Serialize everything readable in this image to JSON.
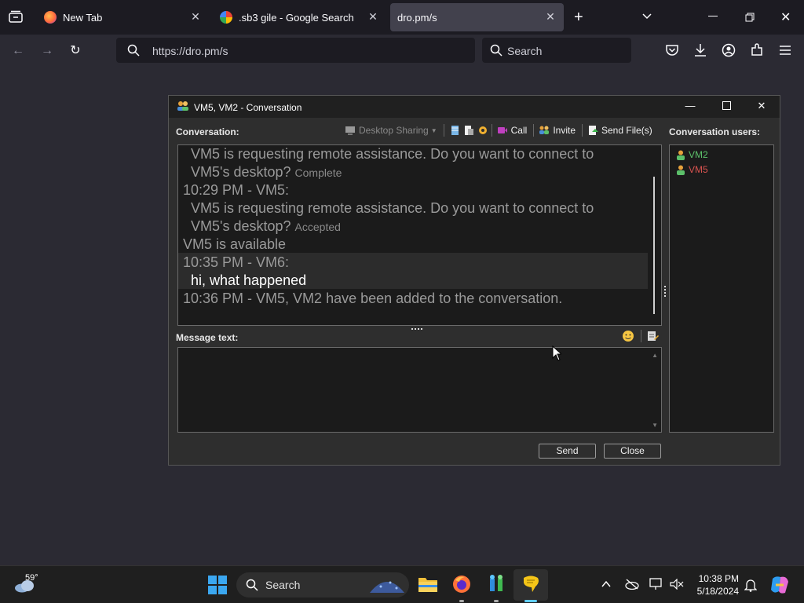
{
  "browser": {
    "tabs": [
      {
        "label": "New Tab"
      },
      {
        "label": ".sb3 gile - Google Search"
      },
      {
        "label": "dro.pm/s"
      }
    ],
    "url": "https://dro.pm/s",
    "search_placeholder": "Search"
  },
  "dialog": {
    "title": "VM5, VM2 - Conversation",
    "conversation_label": "Conversation:",
    "toolbar": {
      "desktop_sharing": "Desktop Sharing",
      "call": "Call",
      "invite": "Invite",
      "send_files": "Send File(s)"
    },
    "conversation_users_label": "Conversation users:",
    "messages": [
      {
        "text": "VM5 is requesting remote assistance. Do you want to connect to"
      },
      {
        "text": "VM5's desktop?",
        "status": "Complete"
      },
      {
        "text": "10:29 PM - VM5:"
      },
      {
        "text": "VM5 is requesting remote assistance. Do you want to connect to"
      },
      {
        "text": "VM5's desktop?",
        "status": "Accepted"
      },
      {
        "text": "VM5 is available"
      },
      {
        "text": "10:35 PM - VM6:"
      },
      {
        "text": "hi, what happened"
      },
      {
        "text": "10:36 PM - VM5, VM2 have been added to the conversation."
      }
    ],
    "message_text_label": "Message text:",
    "message_value": "",
    "users": [
      {
        "name": "VM2",
        "color": "#5cc06a"
      },
      {
        "name": "VM5",
        "color": "#d9534f"
      }
    ],
    "send_label": "Send",
    "close_label": "Close"
  },
  "taskbar": {
    "weather_temp": "59°",
    "search_label": "Search",
    "time": "10:38 PM",
    "date": "5/18/2024"
  }
}
